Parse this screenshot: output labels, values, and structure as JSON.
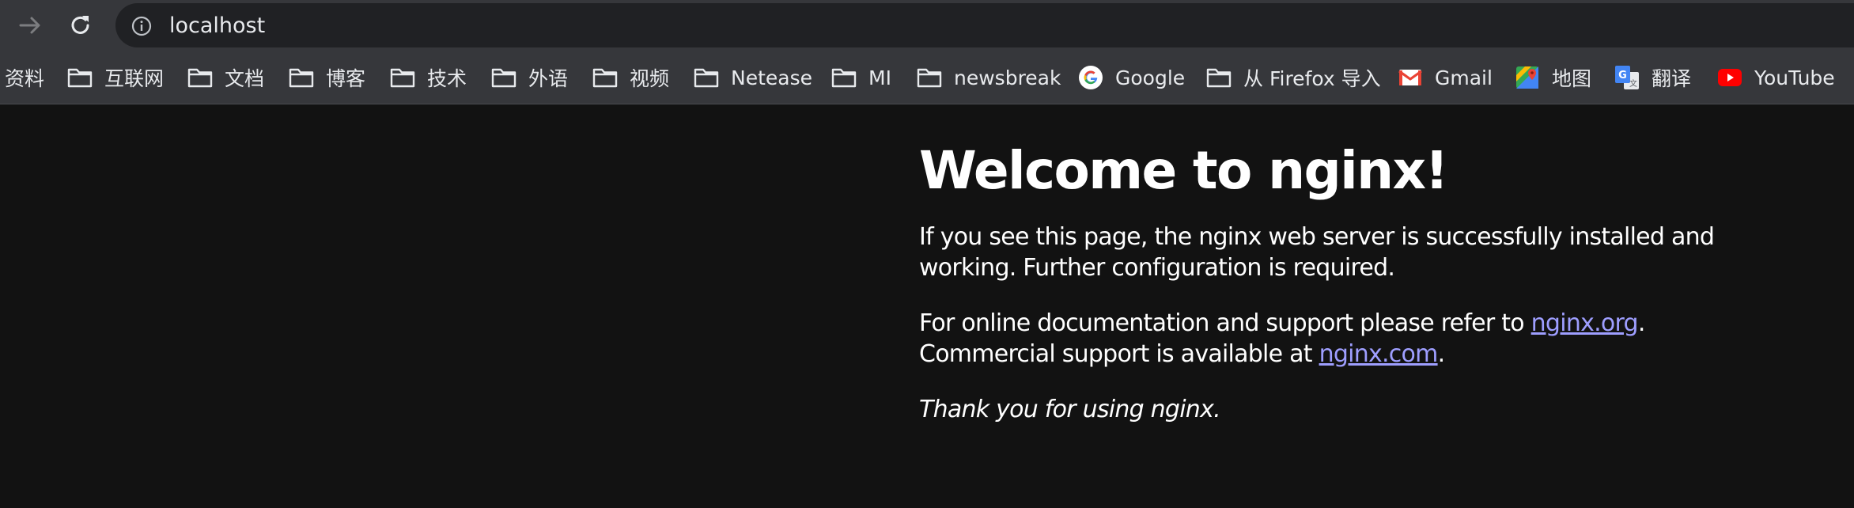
{
  "browser": {
    "url": "localhost",
    "nav_icons": [
      "forward-arrow-icon",
      "reload-icon",
      "site-info-icon"
    ]
  },
  "bookmarks": [
    {
      "label": "资料",
      "icon": ""
    },
    {
      "label": "互联网",
      "icon": "folder-icon"
    },
    {
      "label": "文档",
      "icon": "folder-icon"
    },
    {
      "label": "博客",
      "icon": "folder-icon"
    },
    {
      "label": "技术",
      "icon": "folder-icon"
    },
    {
      "label": "外语",
      "icon": "folder-icon"
    },
    {
      "label": "视频",
      "icon": "folder-icon"
    },
    {
      "label": "Netease",
      "icon": "folder-icon"
    },
    {
      "label": "MI",
      "icon": "folder-icon"
    },
    {
      "label": "newsbreak",
      "icon": "folder-icon"
    },
    {
      "label": "Google",
      "icon": "google-icon"
    },
    {
      "label": "从 Firefox 导入",
      "icon": "folder-icon"
    },
    {
      "label": "Gmail",
      "icon": "gmail-icon"
    },
    {
      "label": "地图",
      "icon": "maps-icon"
    },
    {
      "label": "翻译",
      "icon": "translate-icon"
    },
    {
      "label": "YouTube",
      "icon": "youtube-icon"
    }
  ],
  "page": {
    "heading": "Welcome to nginx!",
    "p1": "If you see this page, the nginx web server is successfully installed and working. Further configuration is required.",
    "p2_before": "For online documentation and support please refer to ",
    "p2_link": "nginx.org",
    "p2_mid": ". Commercial support is available at ",
    "p2_link2": "nginx.com",
    "p2_end": ".",
    "p3": "Thank you for using nginx.",
    "link_color": "#9e9eff",
    "background": "#121212"
  }
}
